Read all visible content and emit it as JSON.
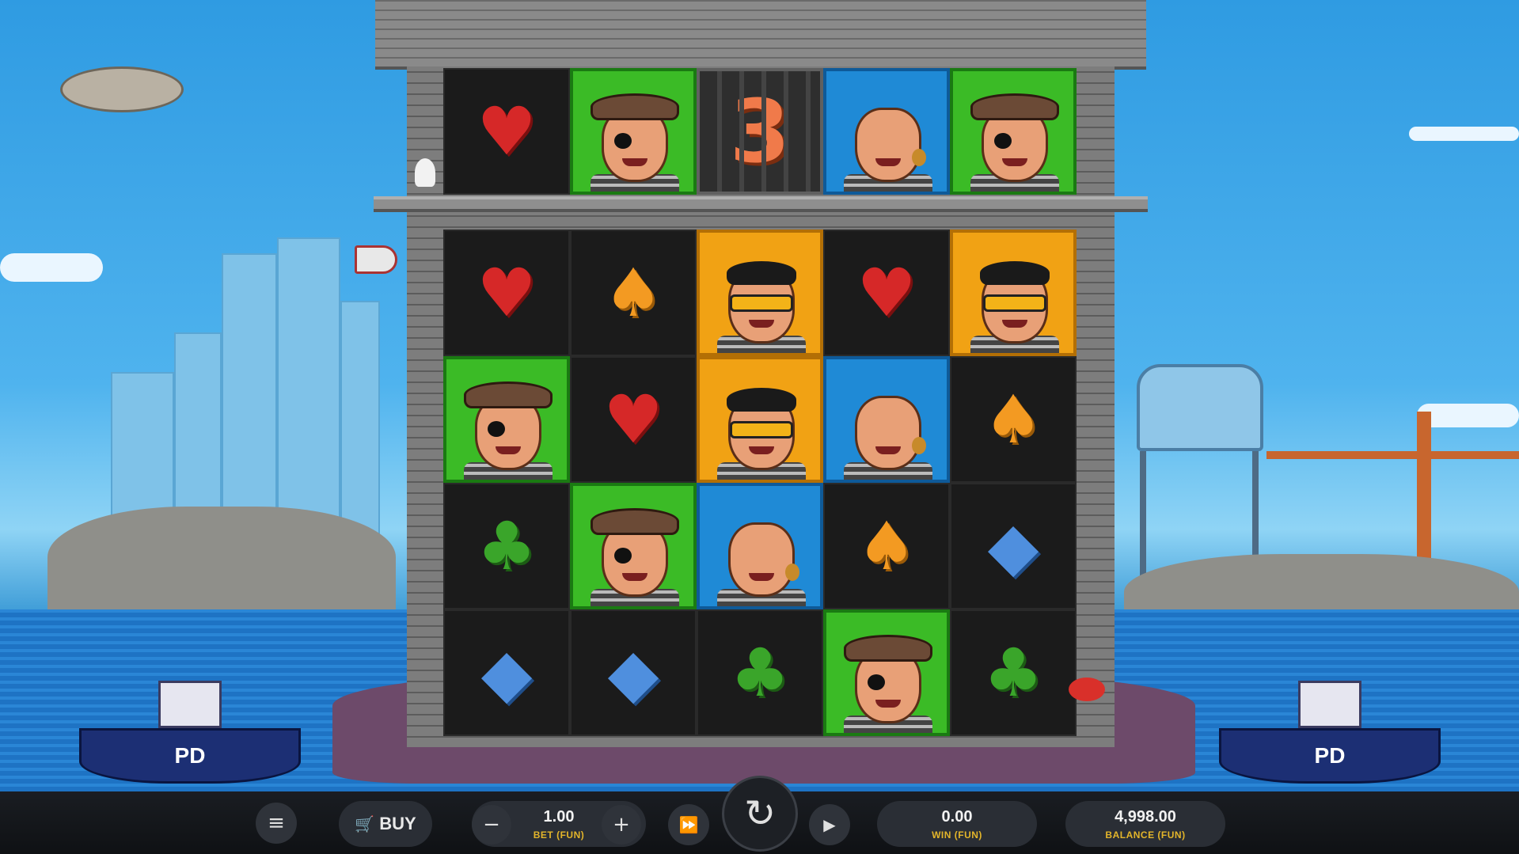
{
  "game": {
    "top_row": [
      {
        "type": "suit",
        "suit": "heart",
        "glyph": "♥"
      },
      {
        "type": "face",
        "variant": "eyepatch-hat",
        "bg": "green"
      },
      {
        "type": "jail",
        "number": "3"
      },
      {
        "type": "face",
        "variant": "bald-bird",
        "bg": "blue"
      },
      {
        "type": "face",
        "variant": "eyepatch-hat",
        "bg": "green"
      }
    ],
    "grid": [
      [
        {
          "type": "suit",
          "suit": "heart",
          "glyph": "♥"
        },
        {
          "type": "suit",
          "suit": "spade",
          "glyph": "♠"
        },
        {
          "type": "face",
          "variant": "sunglasses",
          "bg": "orange"
        },
        {
          "type": "suit",
          "suit": "heart",
          "glyph": "♥"
        },
        {
          "type": "face",
          "variant": "sunglasses",
          "bg": "orange"
        }
      ],
      [
        {
          "type": "face",
          "variant": "eyepatch-hat",
          "bg": "green"
        },
        {
          "type": "suit",
          "suit": "heart",
          "glyph": "♥"
        },
        {
          "type": "face",
          "variant": "sunglasses",
          "bg": "orange"
        },
        {
          "type": "face",
          "variant": "bald-bird",
          "bg": "blue"
        },
        {
          "type": "suit",
          "suit": "spade",
          "glyph": "♠"
        }
      ],
      [
        {
          "type": "suit",
          "suit": "club",
          "glyph": "♣"
        },
        {
          "type": "face",
          "variant": "eyepatch-hat",
          "bg": "green"
        },
        {
          "type": "face",
          "variant": "bald-bird",
          "bg": "blue"
        },
        {
          "type": "suit",
          "suit": "spade",
          "glyph": "♠"
        },
        {
          "type": "suit",
          "suit": "diamond",
          "glyph": "◆"
        }
      ],
      [
        {
          "type": "suit",
          "suit": "diamond",
          "glyph": "◆"
        },
        {
          "type": "suit",
          "suit": "diamond",
          "glyph": "◆"
        },
        {
          "type": "suit",
          "suit": "club",
          "glyph": "♣"
        },
        {
          "type": "face",
          "variant": "eyepatch-hat",
          "bg": "green"
        },
        {
          "type": "suit",
          "suit": "club",
          "glyph": "♣"
        }
      ]
    ],
    "boat_label": "PD"
  },
  "controls": {
    "menu_icon": "≡",
    "buy_label": "BUY",
    "minus_icon": "−",
    "bet_value": "1.00",
    "bet_label": "BET (FUN)",
    "plus_icon": "+",
    "turbo_icon": "⏩",
    "spin_icon": "↻",
    "autoplay_icon": "▶",
    "win_value": "0.00",
    "win_label": "WIN (FUN)",
    "balance_value": "4,998.00",
    "balance_label": "BALANCE (FUN)"
  },
  "colors": {
    "green": "#3bbb26",
    "blue": "#1f8ad6",
    "orange": "#f1a214",
    "accent_label": "#e3b52a"
  }
}
